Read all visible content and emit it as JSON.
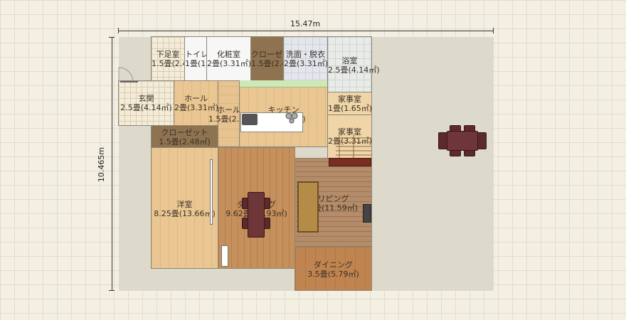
{
  "dimensions": {
    "width": "15.47m",
    "height": "10.465m"
  },
  "rooms": {
    "foot_wash": {
      "name": "下足室",
      "size": "1.5畳(2.48㎡)"
    },
    "toilet": {
      "name": "トイレ",
      "size": "1畳(1.65㎡)"
    },
    "powder_room": {
      "name": "化粧室",
      "size": "2畳(3.31㎡)"
    },
    "closet_top": {
      "name": "クローゼット",
      "size": "1.5畳(2.48㎡)"
    },
    "wash_changing": {
      "name": "洗面・脱衣",
      "size": "2畳(3.31㎡)"
    },
    "bath": {
      "name": "浴室",
      "size": "2.5畳(4.14㎡)"
    },
    "entrance": {
      "name": "玄関",
      "size": "2.5畳(4.14㎡)"
    },
    "hall_1": {
      "name": "ホール",
      "size": "2畳(3.31㎡)"
    },
    "hall_2": {
      "name": "ホール",
      "size": "1.5畳(2.48㎡)"
    },
    "kitchen": {
      "name": "キッチン",
      "size": "6畳(9.93㎡)"
    },
    "utility_1": {
      "name": "家事室",
      "size": "1畳(1.65㎡)"
    },
    "utility_2": {
      "name": "家事室",
      "size": "2畳(3.31㎡)"
    },
    "closet_mid": {
      "name": "クローゼット",
      "size": "1.5畳(2.48㎡)"
    },
    "western_room": {
      "name": "洋室",
      "size": "8.25畳(13.66㎡)"
    },
    "dining_1": {
      "name": "ダイニング",
      "size": "9.62畳(15.93㎡)"
    },
    "living": {
      "name": "リビング",
      "size": "7畳(11.59㎡)"
    },
    "dining_2": {
      "name": "ダイニング",
      "size": "3.5畳(5.79㎡)"
    }
  },
  "colors": {
    "background": "#f3efe2",
    "lot": "#ddd9cb",
    "furniture": "#5d2a2c"
  },
  "icons": [
    "door-swing-icon",
    "sink-icon",
    "stove-icon",
    "stairs-icon",
    "tv-icon",
    "sofa-icon",
    "dining-set-icon"
  ]
}
